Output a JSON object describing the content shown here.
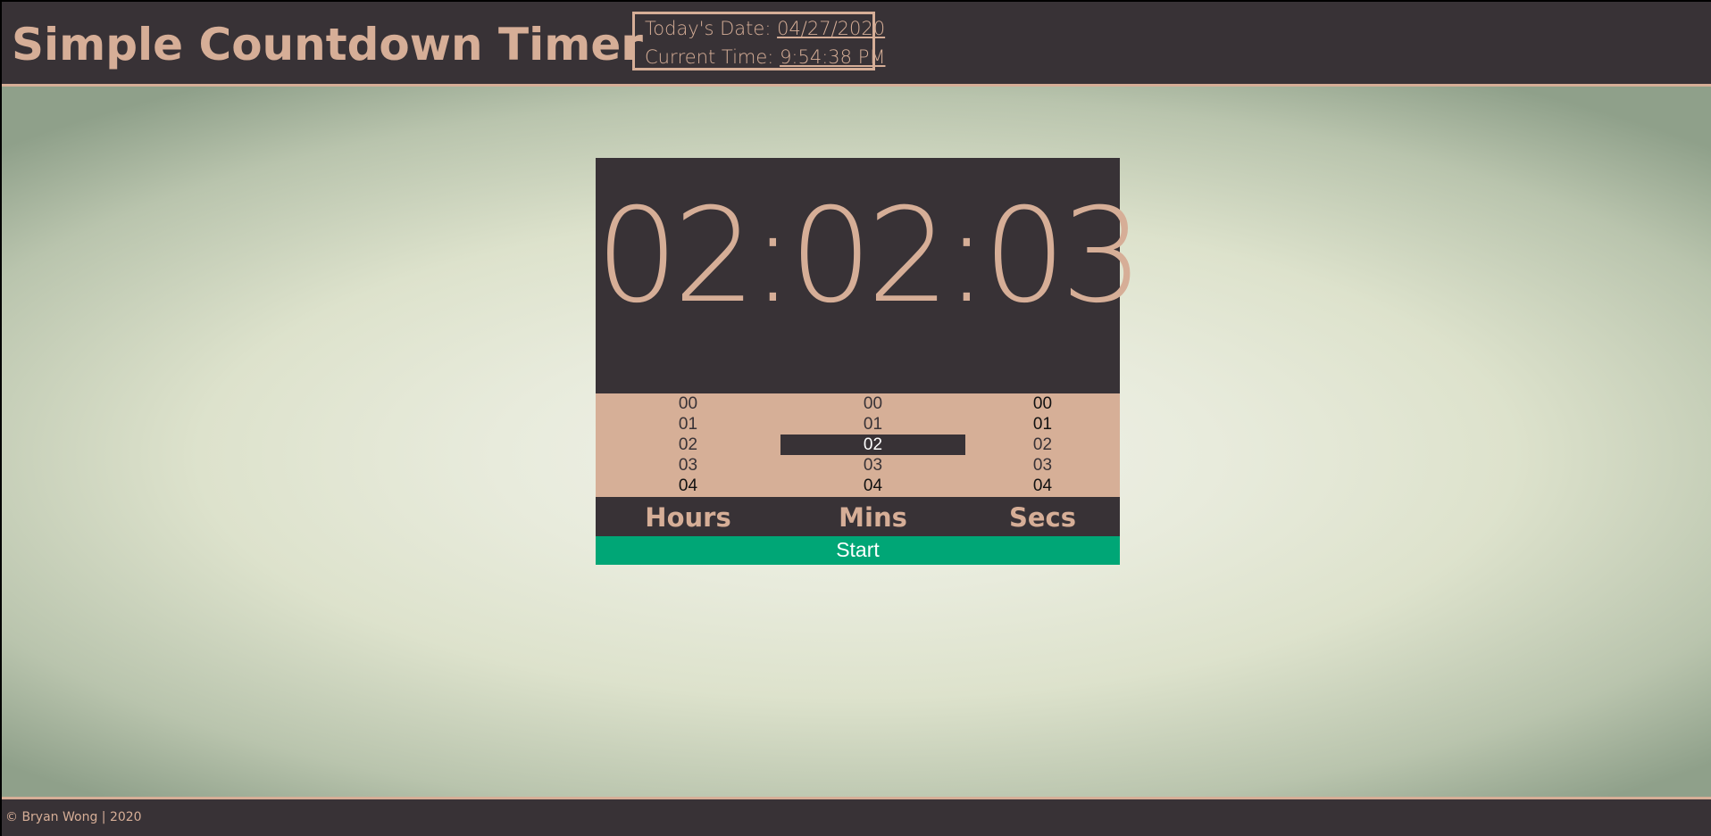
{
  "header": {
    "title": "Simple Countdown Timer",
    "date_label": "Today's Date: ",
    "date_value": "04/27/2020",
    "time_label": "Current Time: ",
    "time_value": "9:54:38 PM"
  },
  "timer": {
    "display": "02:02:03",
    "hours": {
      "label": "Hours",
      "options": [
        "00",
        "01",
        "02",
        "03",
        "04"
      ],
      "selected": null
    },
    "minutes": {
      "label": "Mins",
      "options": [
        "00",
        "01",
        "02",
        "03",
        "04"
      ],
      "selected": "02"
    },
    "seconds": {
      "label": "Secs",
      "options": [
        "00",
        "01",
        "02",
        "03",
        "04"
      ],
      "selected": null
    },
    "start_label": "Start"
  },
  "footer": {
    "text": "© Bryan Wong | 2020"
  },
  "colors": {
    "dark": "#383236",
    "accent": "#d6ae97",
    "start": "#00a676"
  }
}
